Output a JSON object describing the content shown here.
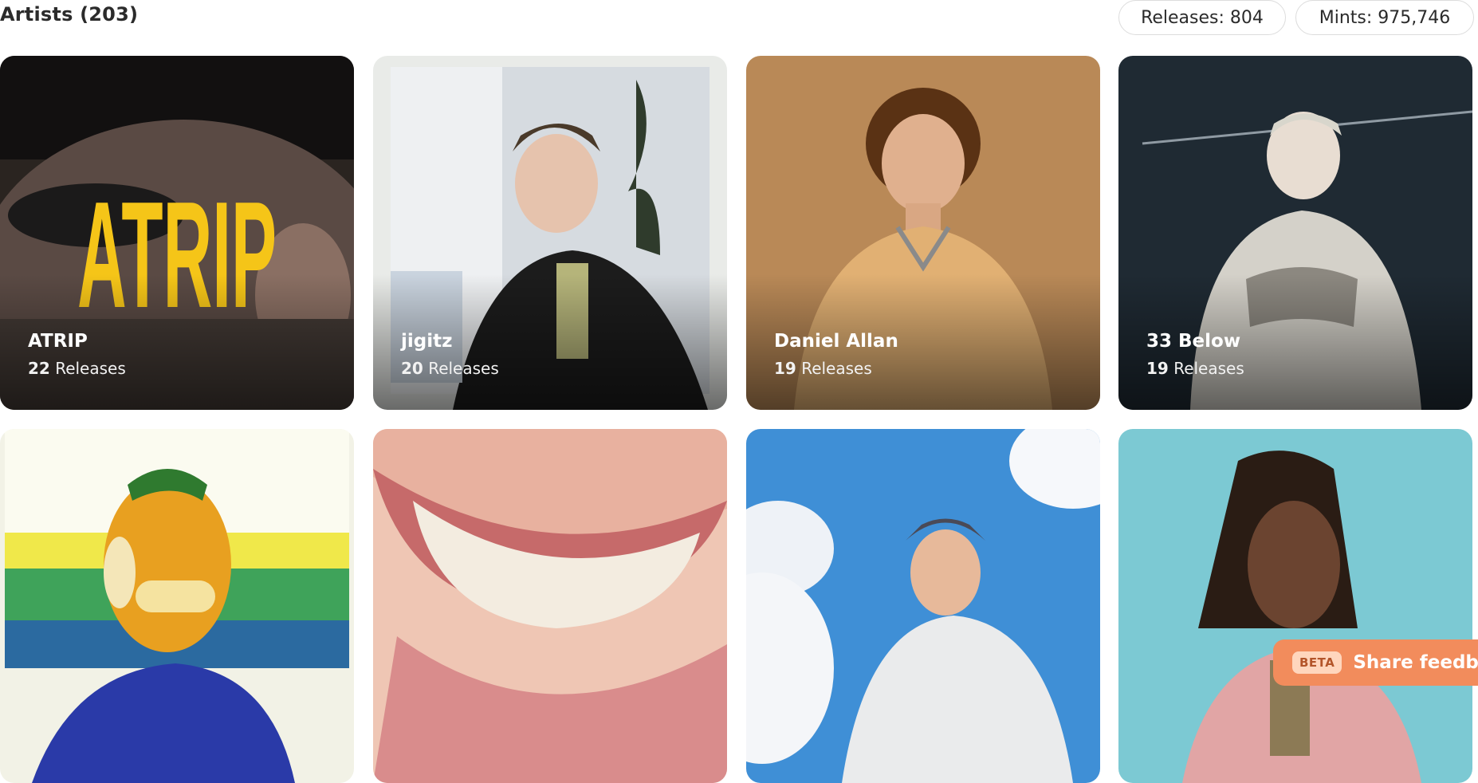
{
  "header": {
    "title": "Artists (203)",
    "releases_stat": "Releases: 804",
    "mints_stat": "Mints: 975,746"
  },
  "artists": [
    {
      "name": "ATRIP",
      "count": "22",
      "label": " Releases",
      "logo_text": "ATRIP"
    },
    {
      "name": "jigitz",
      "count": "20",
      "label": " Releases"
    },
    {
      "name": "Daniel Allan",
      "count": "19",
      "label": " Releases"
    },
    {
      "name": "33 Below",
      "count": "19",
      "label": " Releases"
    },
    {
      "name": "",
      "count": "",
      "label": ""
    },
    {
      "name": "",
      "count": "",
      "label": ""
    },
    {
      "name": "",
      "count": "",
      "label": ""
    },
    {
      "name": "",
      "count": "",
      "label": ""
    }
  ],
  "feedback": {
    "badge": "BETA",
    "label": "Share feedback"
  },
  "colors": {
    "accent": "#f28c5c",
    "text": "#2b2b2b"
  }
}
